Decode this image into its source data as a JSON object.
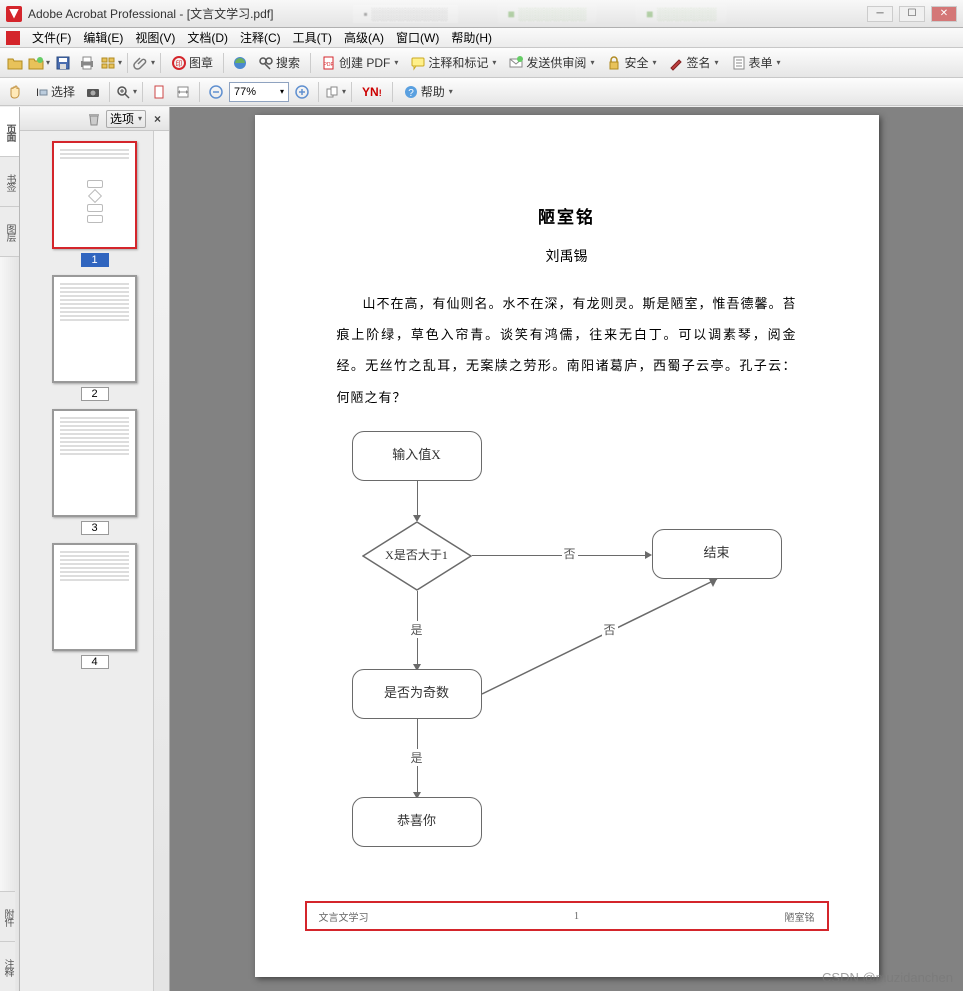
{
  "title": "Adobe Acrobat Professional - [文言文学习.pdf]",
  "tabs_blur": [
    "",
    "",
    ""
  ],
  "menu": {
    "file": "文件(F)",
    "edit": "编辑(E)",
    "view": "视图(V)",
    "document": "文档(D)",
    "comment": "注释(C)",
    "tools": "工具(T)",
    "advanced": "高级(A)",
    "window": "窗口(W)",
    "help": "帮助(H)"
  },
  "toolbar1": {
    "stamp": "图章",
    "search": "搜索",
    "create_pdf": "创建 PDF",
    "comment_markup": "注释和标记",
    "send_review": "发送供审阅",
    "secure": "安全",
    "sign": "签名",
    "forms": "表单"
  },
  "toolbar2": {
    "select": "选择",
    "zoom_level": "77%",
    "help": "帮助",
    "yahoo": "Y!"
  },
  "thumb_panel": {
    "options": "选项"
  },
  "thumbs": [
    {
      "n": "1"
    },
    {
      "n": "2"
    },
    {
      "n": "3"
    },
    {
      "n": "4"
    }
  ],
  "ribbon": {
    "pages": "页面",
    "bookmarks": "书签",
    "layers": "图层",
    "attachments": "附件",
    "comments": "注释"
  },
  "doc": {
    "title": "陋室铭",
    "author": "刘禹锡",
    "body": "山不在高，有仙则名。水不在深，有龙则灵。斯是陋室，惟吾德馨。苔痕上阶绿，草色入帘青。谈笑有鸿儒，往来无白丁。可以调素琴，阅金经。无丝竹之乱耳，无案牍之劳形。南阳诸葛庐，西蜀子云亭。孔子云：何陋之有？",
    "flow": {
      "n1": "输入值X",
      "n2": "X是否大于1",
      "n3": "结束",
      "n4": "是否为奇数",
      "n5": "恭喜你",
      "e_no": "否",
      "e_yes": "是"
    },
    "footer": {
      "left": "文言文学习",
      "center": "1",
      "right": "陋室铭"
    }
  },
  "watermark": "CSDN @muzidanchen"
}
